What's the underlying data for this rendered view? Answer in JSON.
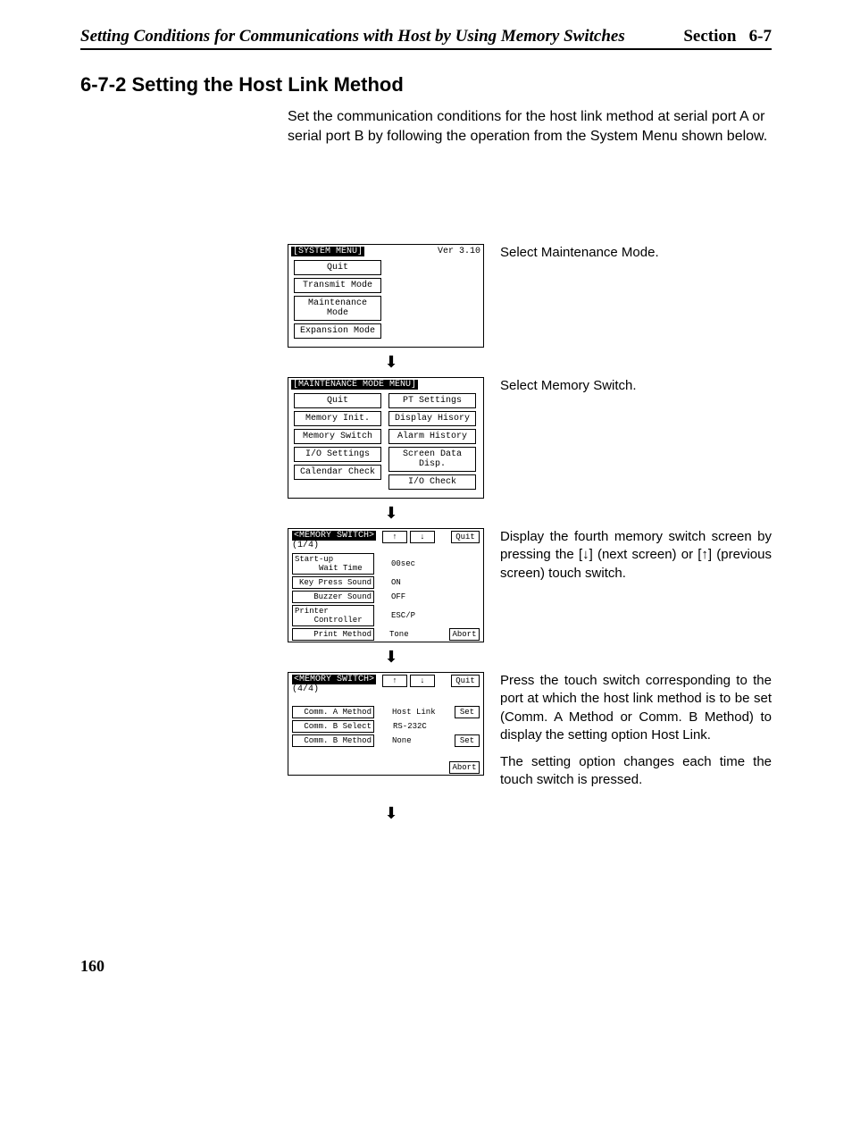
{
  "header": {
    "left": "Setting Conditions for Communications with Host by Using Memory Switches",
    "section_label": "Section",
    "section_num": "6-7"
  },
  "title": "6-7-2  Setting the Host Link Method",
  "intro": "Set the communication conditions for the host link method at serial port A or serial port B by following the operation from the System Menu shown below.",
  "screen1": {
    "title": "[SYSTEM MENU]",
    "version": "Ver 3.10",
    "buttons": [
      "Quit",
      "Transmit Mode",
      "Maintenance Mode",
      "Expansion Mode"
    ],
    "desc": "Select Maintenance Mode."
  },
  "screen2": {
    "title": "[MAINTENANCE MODE MENU]",
    "left": [
      "Quit",
      "Memory Init.",
      "Memory Switch",
      "I/O Settings",
      "Calendar Check"
    ],
    "right": [
      "PT Settings",
      "Display Hisory",
      "Alarm History",
      "Screen Data Disp.",
      "I/O Check"
    ],
    "desc": "Select Memory Switch."
  },
  "screen3": {
    "title": "<MEMORY SWITCH>",
    "page": "(1/4)",
    "nav_up": "↑",
    "nav_down": "↓",
    "quit": "Quit",
    "abort": "Abort",
    "rows": [
      {
        "label": "Start-up\n     Wait Time",
        "val": "00sec"
      },
      {
        "label": "Key Press Sound",
        "val": "ON"
      },
      {
        "label": "Buzzer Sound",
        "val": "OFF"
      },
      {
        "label": "Printer\n    Controller",
        "val": "ESC/P"
      },
      {
        "label": "Print Method",
        "val": "Tone"
      }
    ],
    "desc": "Display the fourth memory switch screen by pressing the [↓] (next screen) or [↑] (previous screen) touch switch."
  },
  "screen4": {
    "title": "<MEMORY SWITCH>",
    "page": "(4/4)",
    "nav_up": "↑",
    "nav_down": "↓",
    "quit": "Quit",
    "set": "Set",
    "abort": "Abort",
    "rows": [
      {
        "label": "Comm. A Method",
        "val": "Host Link",
        "set": true
      },
      {
        "label": "Comm. B Select",
        "val": "RS-232C",
        "set": false
      },
      {
        "label": "Comm. B Method",
        "val": "None",
        "set": true
      }
    ],
    "desc1": "Press the touch switch corresponding to the port at which the host link method is to be set (Comm. A Method or Comm. B Method) to display the setting option Host Link.",
    "desc2": "The setting option changes each time the touch switch is pressed."
  },
  "page_number": "160"
}
